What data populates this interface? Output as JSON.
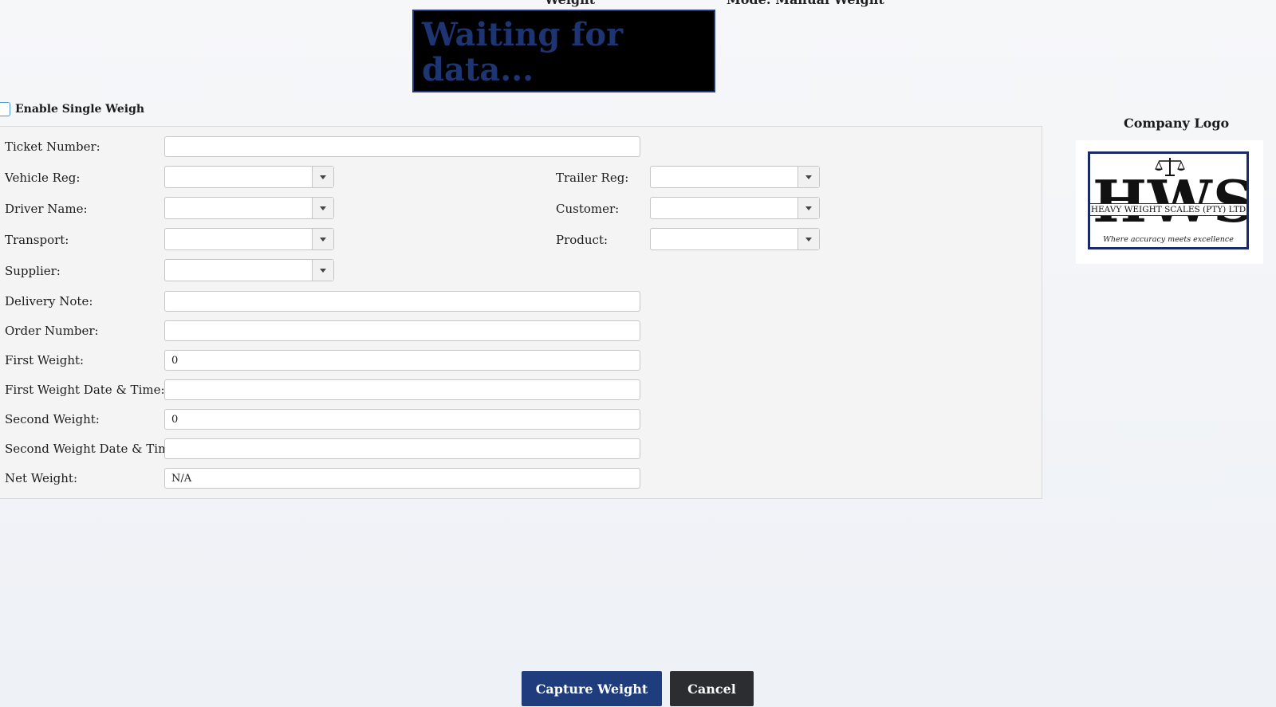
{
  "header": {
    "weight_label": "Weight",
    "mode_label": "Mode: Manual Weight"
  },
  "weight_display": "Waiting for data...",
  "single_weigh": {
    "label": "Enable Single Weigh",
    "checked": false
  },
  "form": {
    "ticket_number": {
      "label": "Ticket Number:",
      "value": ""
    },
    "vehicle_reg": {
      "label": "Vehicle Reg:",
      "value": ""
    },
    "trailer_reg": {
      "label": "Trailer Reg:",
      "value": ""
    },
    "driver_name": {
      "label": "Driver Name:",
      "value": ""
    },
    "customer": {
      "label": "Customer:",
      "value": ""
    },
    "transport": {
      "label": "Transport:",
      "value": ""
    },
    "product": {
      "label": "Product:",
      "value": ""
    },
    "supplier": {
      "label": "Supplier:",
      "value": ""
    },
    "delivery_note": {
      "label": "Delivery Note:",
      "value": ""
    },
    "order_number": {
      "label": "Order Number:",
      "value": ""
    },
    "first_weight": {
      "label": "First Weight:",
      "value": "0"
    },
    "first_weight_dt": {
      "label": "First Weight Date & Time:",
      "value": ""
    },
    "second_weight": {
      "label": "Second Weight:",
      "value": "0"
    },
    "second_weight_dt": {
      "label": "Second Weight Date & Time:",
      "value": ""
    },
    "net_weight": {
      "label": "Net Weight:",
      "value": "N/A"
    }
  },
  "logo": {
    "title": "Company Logo",
    "letters": "HWS",
    "company": "HEAVY WEIGHT SCALES (PTY) LTD",
    "tagline": "Where accuracy meets excellence"
  },
  "actions": {
    "capture_label": "Capture Weight",
    "cancel_label": "Cancel"
  },
  "colors": {
    "primary": "#1f3d7c",
    "cancel": "#2b2d31",
    "display_bg": "#000000",
    "display_text": "#1e3573"
  }
}
